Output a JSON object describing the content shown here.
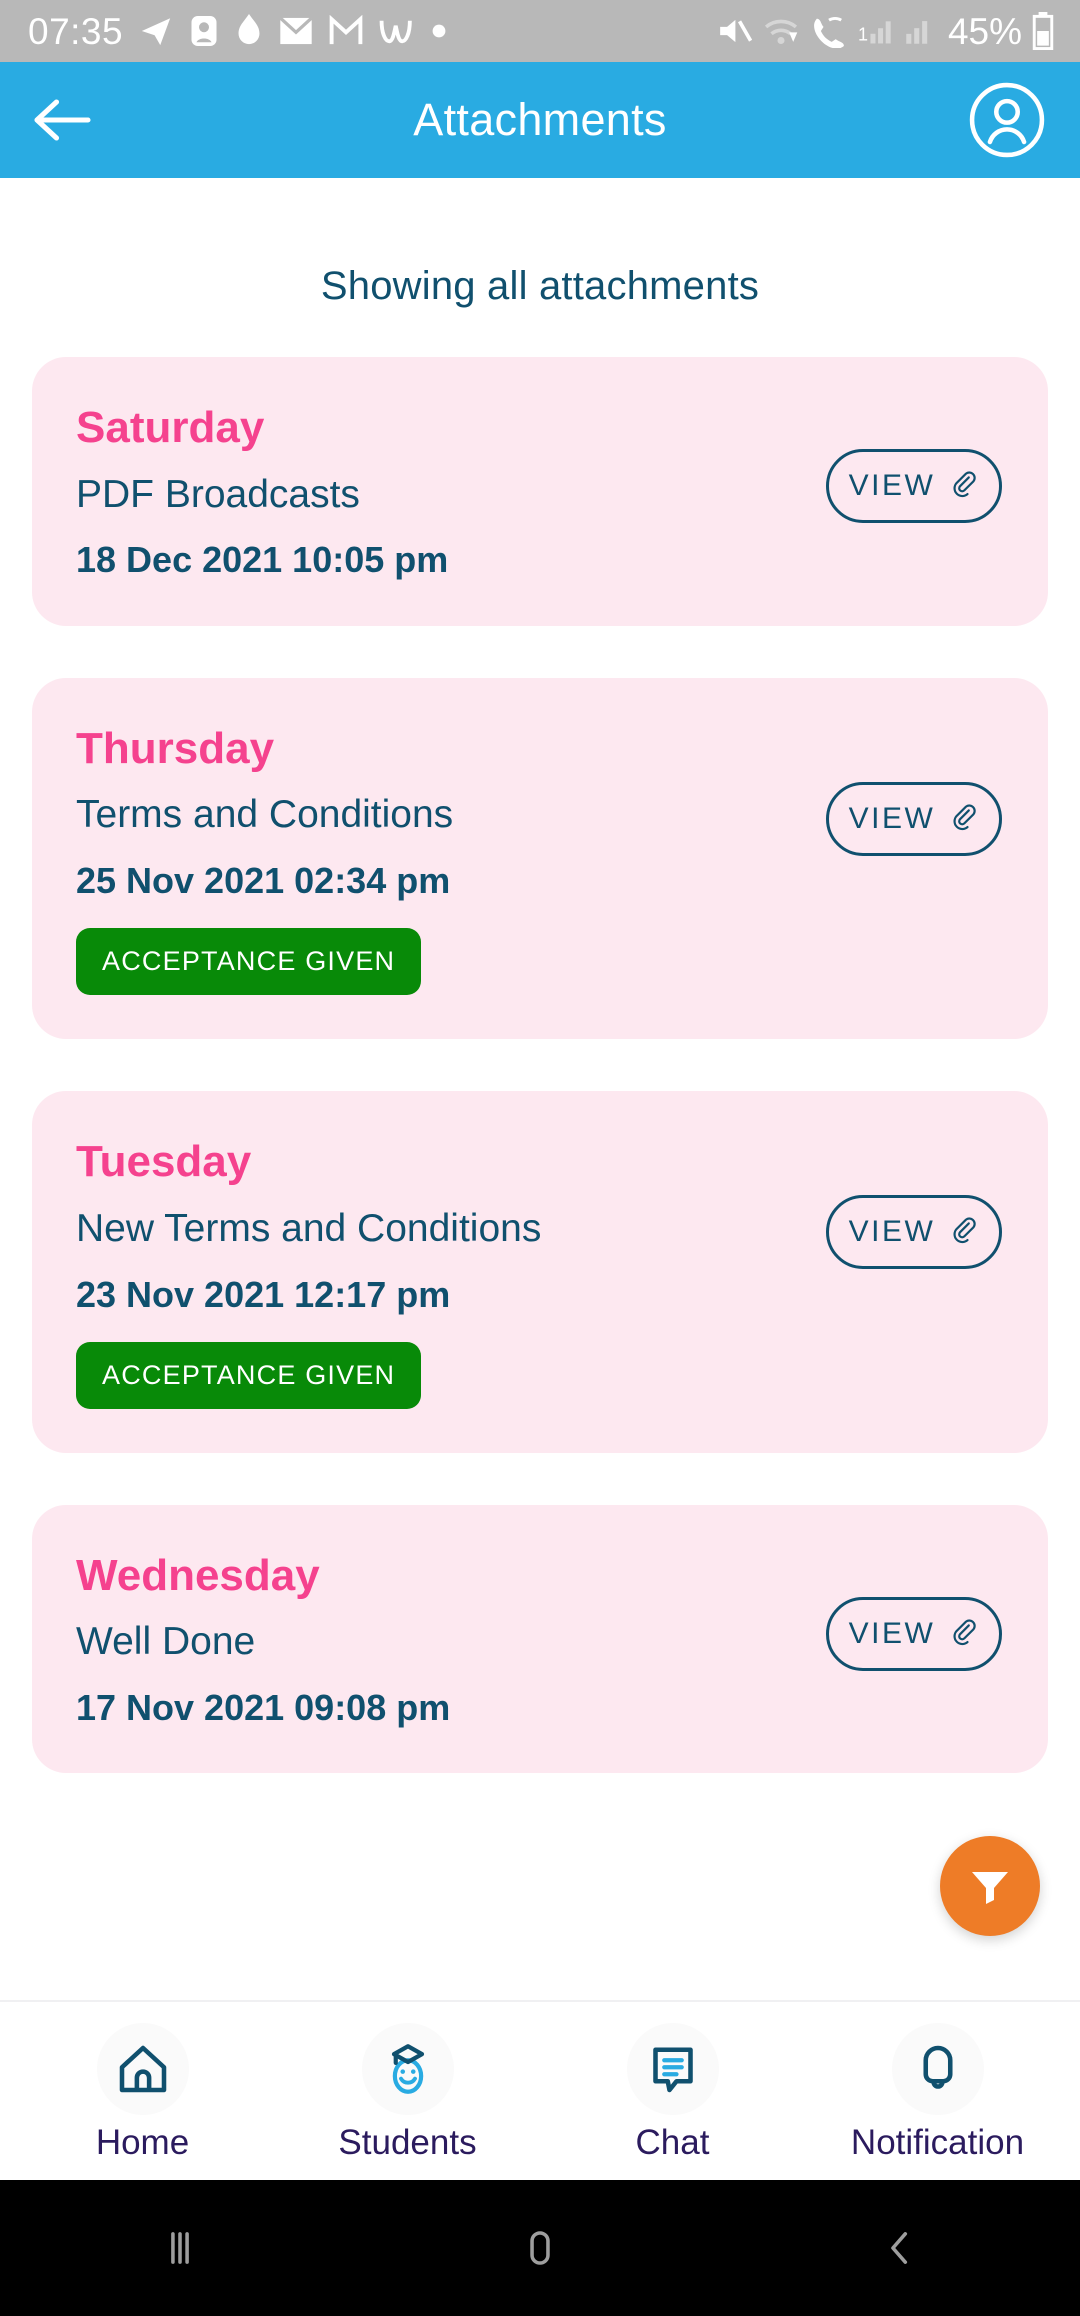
{
  "status_bar": {
    "time": "07:35",
    "battery_percent": "45%",
    "left_icons": [
      "telegram-icon",
      "app-icon",
      "app-icon-2",
      "mail-icon",
      "gmail-icon",
      "w-app-icon",
      "dot-icon"
    ],
    "right_icons": [
      "mute-icon",
      "wifi-icon",
      "call-wifi-icon",
      "signal-1-icon",
      "signal-2-icon",
      "battery-icon"
    ],
    "background": "#b8b8b8"
  },
  "header": {
    "title": "Attachments",
    "back_icon": "back-arrow-icon",
    "avatar_icon": "account-circle-icon",
    "background": "#29ABE2"
  },
  "main": {
    "showing_label": "Showing all attachments",
    "view_label": "VIEW",
    "attachment_icon": "paperclip-icon",
    "card_background": "#FDE8F0",
    "day_color": "#F5428E",
    "text_color": "#10506E",
    "badge_color": "#088A08",
    "cards": [
      {
        "day": "Saturday",
        "subject": "PDF Broadcasts",
        "date": "18 Dec 2021 10:05 pm",
        "badge": null
      },
      {
        "day": "Thursday",
        "subject": "Terms and Conditions",
        "date": "25 Nov 2021 02:34 pm",
        "badge": "ACCEPTANCE GIVEN"
      },
      {
        "day": "Tuesday",
        "subject": "New Terms and Conditions",
        "date": "23 Nov 2021 12:17 pm",
        "badge": "ACCEPTANCE GIVEN"
      },
      {
        "day": "Wednesday",
        "subject": "Well Done",
        "date": "17 Nov 2021 09:08 pm",
        "badge": null
      }
    ]
  },
  "fab": {
    "icon": "filter-funnel-icon",
    "color": "#EE7C27"
  },
  "bottom_nav": {
    "items": [
      {
        "label": "Home",
        "icon": "home-icon"
      },
      {
        "label": "Students",
        "icon": "graduate-student-icon"
      },
      {
        "label": "Chat",
        "icon": "chat-bubble-icon"
      },
      {
        "label": "Notification",
        "icon": "bell-icon"
      }
    ],
    "label_color": "#2B1B5E"
  },
  "android_nav": {
    "recents_icon": "recents-icon",
    "home_icon": "home-pill-icon",
    "back_icon": "android-back-icon"
  }
}
